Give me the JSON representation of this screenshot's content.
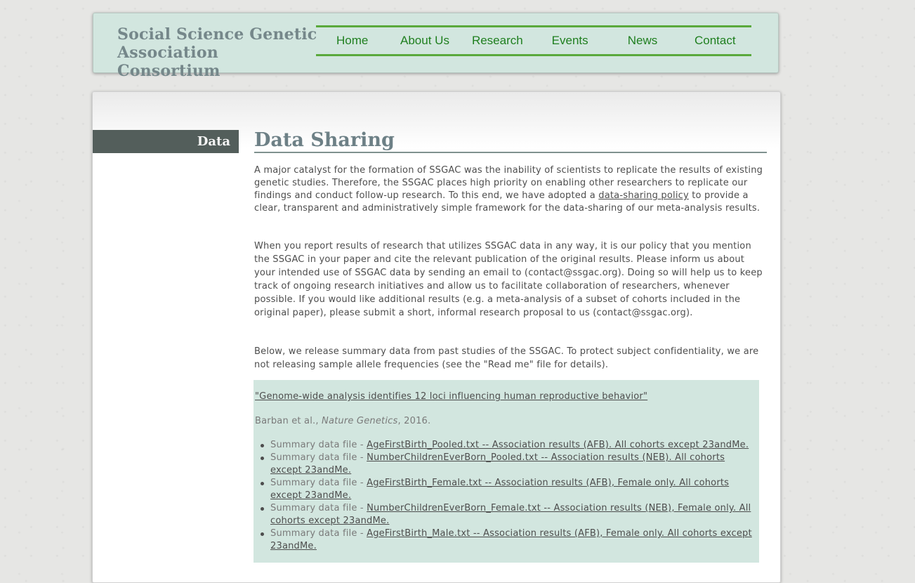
{
  "header": {
    "site_title": "Social Science Genetic Association Consortium",
    "nav": [
      "Home",
      "About Us",
      "Research",
      "Events",
      "News",
      "Contact"
    ]
  },
  "sidebar": {
    "label": "Data"
  },
  "main": {
    "title": "Data Sharing",
    "p1_before": "A major catalyst for the formation of SSGAC was the inability of scientists to replicate the results of existing genetic studies. Therefore, the SSGAC places high priority on enabling other researchers to replicate our findings and conduct follow-up research. To this end, we have adopted a ",
    "p1_link": "data-sharing policy",
    "p1_after": " to provide a clear, transparent and administratively simple framework for the data-sharing of our meta-analysis results.",
    "p2": "When you report results of research that utilizes SSGAC data in any way, it is our policy that you mention the SSGAC in your paper and cite the relevant publication of the original results. Please inform us about your intended use of SSGAC data by sending an email to (contact@ssgac.org). Doing so will help us to keep track of ongoing research initiatives and allow us to facilitate collaboration of researchers, whenever possible. If you would like additional results (e.g. a meta-analysis of a subset of cohorts included in the original paper), please submit a short, informal research proposal to us (contact@ssgac.org).",
    "p3": "Below, we release summary data from past studies of the SSGAC. To protect subject confidentiality, we are not releasing sample allele frequencies (see the \"Read me\" file for details)."
  },
  "study": {
    "title": "\"Genome-wide analysis identifies 12 loci influencing human reproductive behavior\"",
    "authors": "Barban et al., ",
    "journal": "Nature Genetics",
    "year": ", 2016.",
    "file_prefix": "Summary data file - ",
    "files": [
      " AgeFirstBirth_Pooled.txt -- Association results (AFB). All cohorts except 23andMe.",
      "NumberChildrenEverBorn_Pooled.txt -- Association results (NEB). All cohorts except 23andMe.",
      "AgeFirstBirth_Female.txt -- Association results (AFB), Female only. All cohorts except 23andMe.",
      "NumberChildrenEverBorn_Female.txt -- Association results (NEB), Female only. All cohorts except 23andMe.",
      "AgeFirstBirth_Male.txt -- Association results (AFB), Female only. All cohorts except 23andMe."
    ]
  }
}
